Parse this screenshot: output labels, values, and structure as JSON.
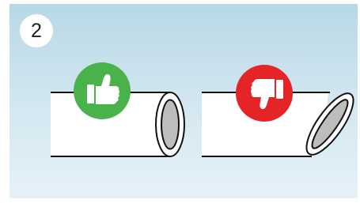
{
  "step": {
    "number": "2"
  },
  "cuts": [
    {
      "verdict": "correct",
      "cut_style": "square",
      "icon": "thumbs-up-icon",
      "color": "#4ab24a"
    },
    {
      "verdict": "incorrect",
      "cut_style": "angled",
      "icon": "thumbs-down-icon",
      "color": "#e52427"
    }
  ],
  "colors": {
    "panel_top": "#b8d8e6",
    "panel_bottom": "#e6f1f7",
    "pipe_fill": "#ffffff",
    "pipe_outline": "#111111",
    "pipe_inner": "#bdbdbd"
  }
}
